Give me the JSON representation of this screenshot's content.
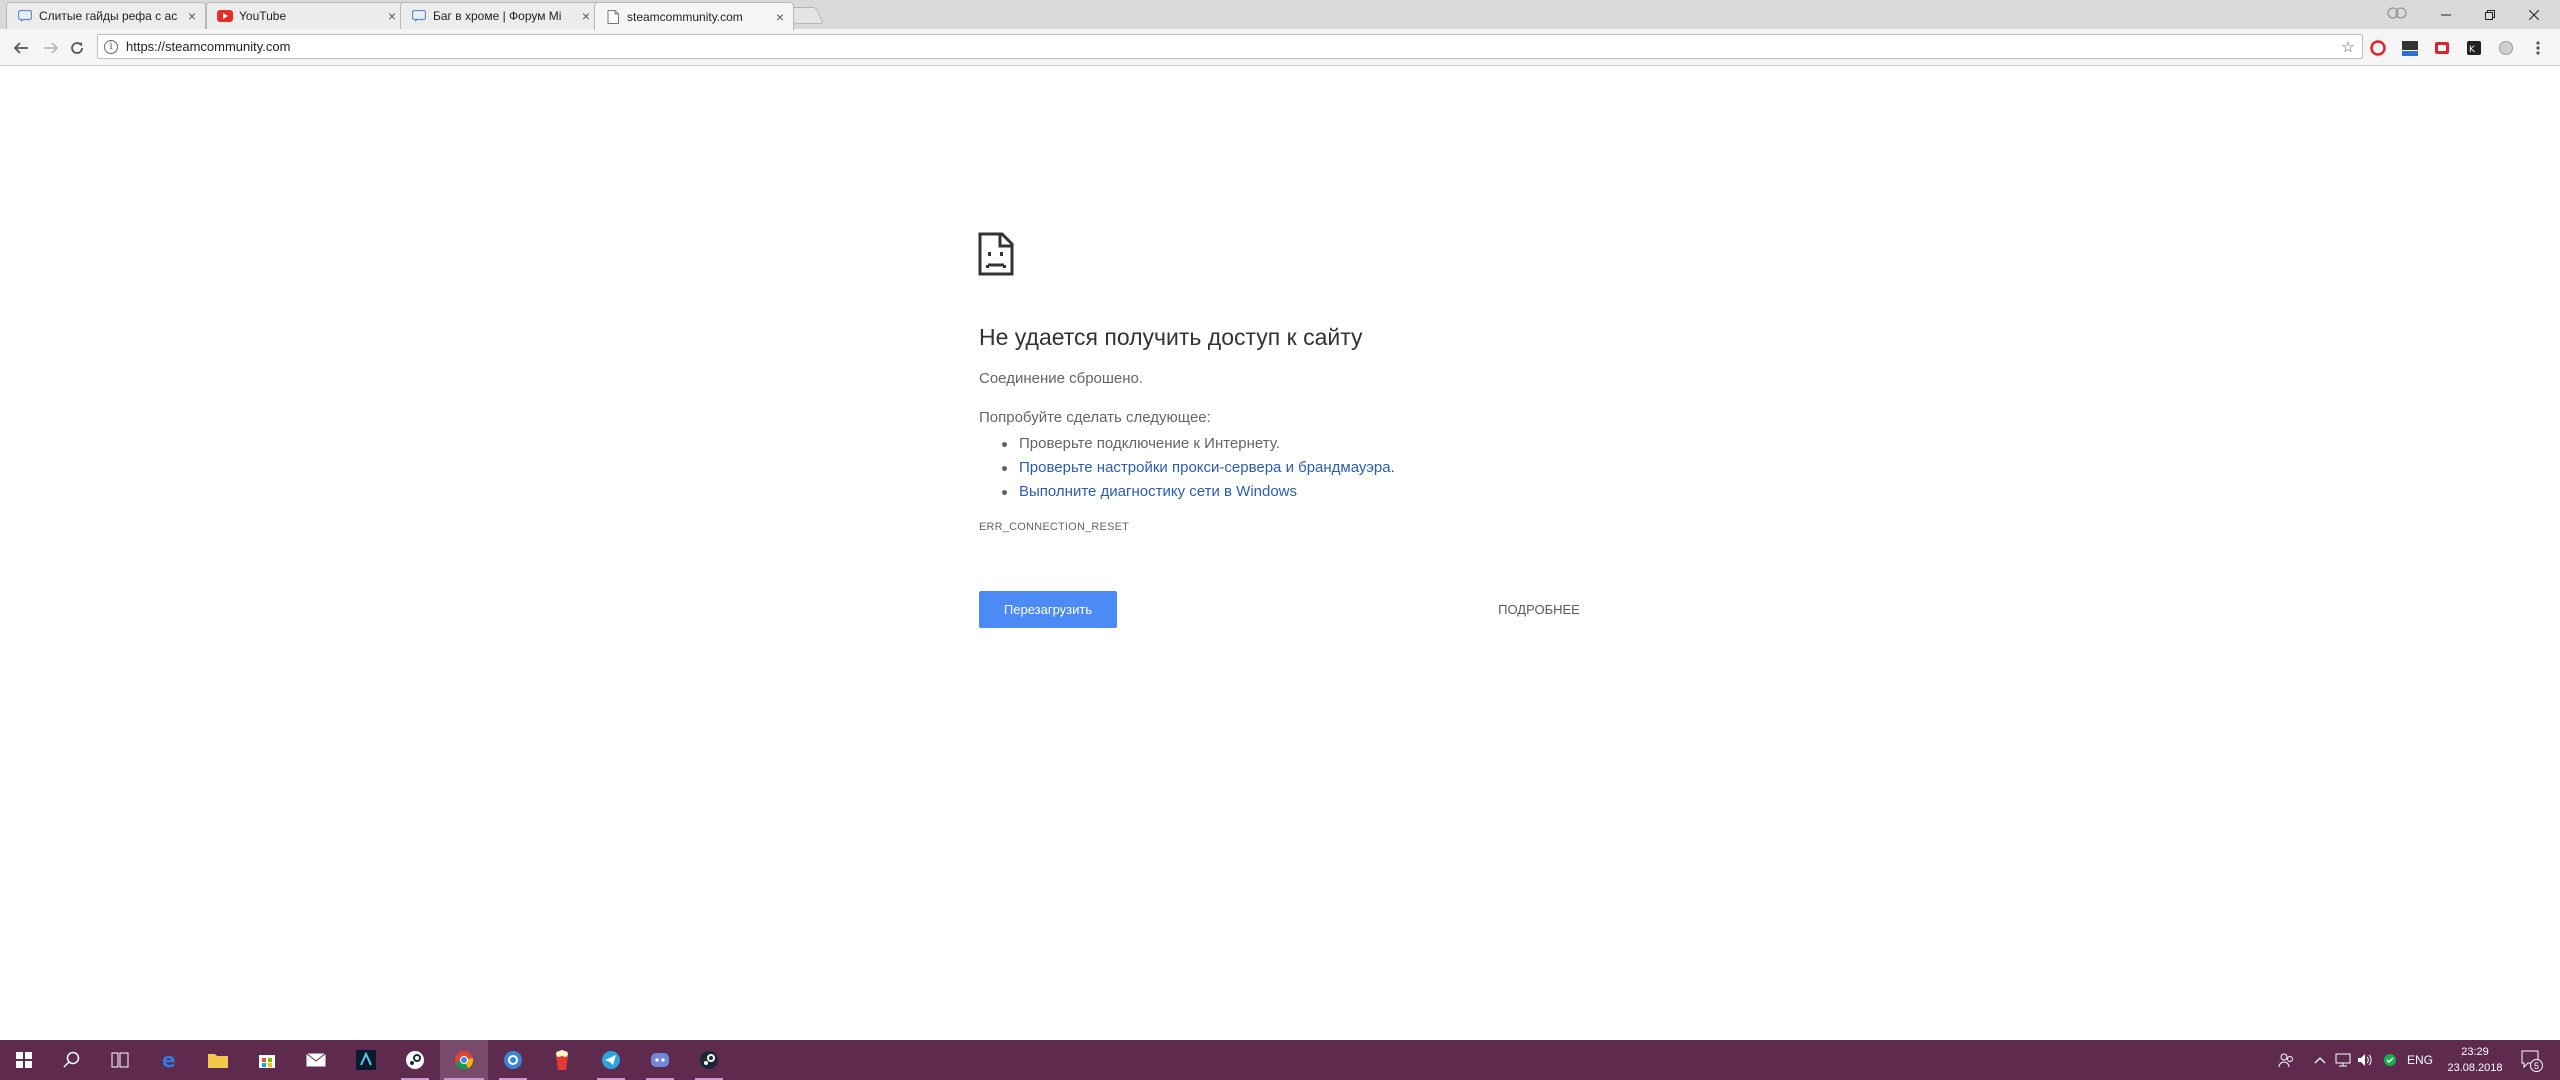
{
  "tabs": [
    {
      "title": "Слитые гайды рефа с ас",
      "favicon": "forum-icon"
    },
    {
      "title": "YouTube",
      "favicon": "youtube-icon"
    },
    {
      "title": "Баг в хроме | Форум Mi",
      "favicon": "forum-icon"
    },
    {
      "title": "steamcommunity.com",
      "favicon": "page-icon"
    }
  ],
  "omnibox": {
    "url": "https://steamcommunity.com"
  },
  "error": {
    "heading": "Не удается получить доступ к сайту",
    "subheading": "Соединение сброшено.",
    "try_label": "Попробуйте сделать следующее:",
    "suggestions": [
      "Проверьте подключение к Интернету.",
      "Проверьте настройки прокси-сервера и брандмауэра.",
      "Выполните диагностику сети в Windows"
    ],
    "code": "ERR_CONNECTION_RESET",
    "reload_label": "Перезагрузить",
    "details_label": "ПОДРОБНЕЕ"
  },
  "taskbar": {
    "language": "ENG",
    "time": "23:29",
    "date": "23.08.2018",
    "notification_count": "5"
  },
  "colors": {
    "accent": "#4c8bf5",
    "link": "#2a5db0",
    "taskbar": "#5e2b4f"
  }
}
